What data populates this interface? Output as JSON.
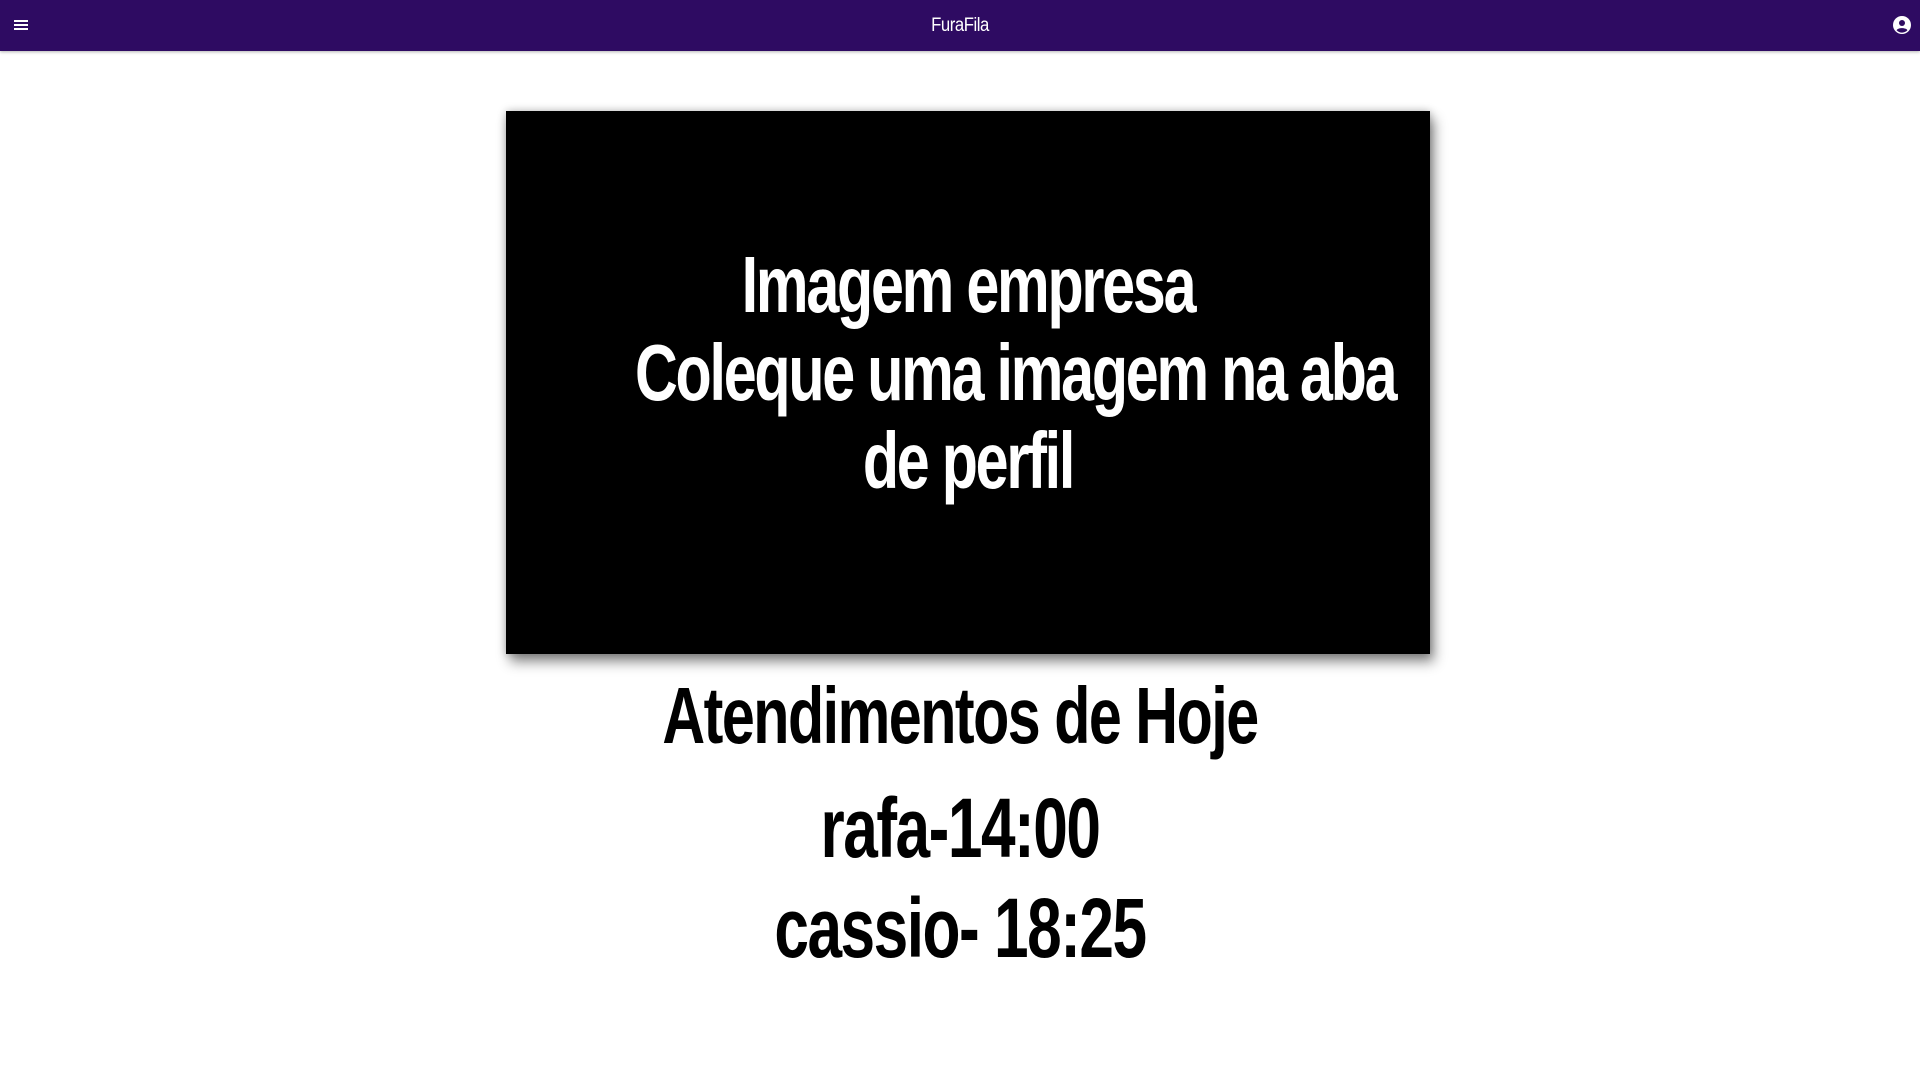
{
  "header": {
    "title": "FuraFila",
    "menu_icon": "hamburger-menu-icon",
    "account_icon": "account-circle-icon",
    "background_color": "#2e0b62"
  },
  "banner": {
    "lines": [
      "Imagem empresa",
      "Coleque uma imagem na aba",
      "de perfil"
    ],
    "background_color": "#000000"
  },
  "main": {
    "title": "Atendimentos de Hoje",
    "appointments": [
      "rafa-14:00",
      "cassio- 18:25"
    ]
  }
}
